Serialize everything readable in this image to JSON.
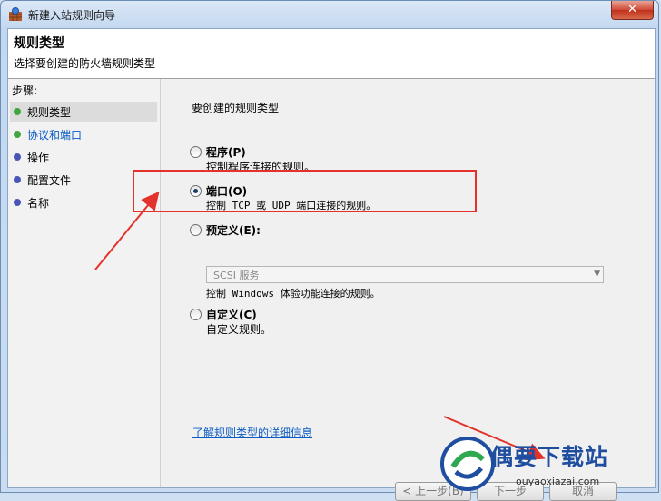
{
  "window": {
    "title": "新建入站规则向导",
    "close_glyph": "✕"
  },
  "header": {
    "title": "规则类型",
    "subtitle": "选择要创建的防火墙规则类型"
  },
  "sidebar": {
    "steps_label": "步骤:",
    "steps": [
      {
        "label": "规则类型",
        "dot_color": "#3fa640"
      },
      {
        "label": "协议和端口",
        "dot_color": "#3fa640"
      },
      {
        "label": "操作",
        "dot_color": "#4b55b8"
      },
      {
        "label": "配置文件",
        "dot_color": "#4b55b8"
      },
      {
        "label": "名称",
        "dot_color": "#4b55b8"
      }
    ]
  },
  "main": {
    "prompt": "要创建的规则类型",
    "options": [
      {
        "title": "程序(P)",
        "desc": "控制程序连接的规则。",
        "checked": false
      },
      {
        "title": "端口(O)",
        "desc": "控制 TCP 或 UDP 端口连接的规则。",
        "checked": true
      },
      {
        "title": "预定义(E):",
        "desc": "控制 Windows 体验功能连接的规则。",
        "checked": false
      },
      {
        "title": "自定义(C)",
        "desc": "自定义规则。",
        "checked": false
      }
    ],
    "predefined_select": {
      "value": "iSCSI 服务"
    },
    "info_link": "了解规则类型的详细信息"
  },
  "buttons": {
    "back": "< 上一步(B)",
    "next": "下一步",
    "cancel": "取消"
  },
  "watermark": {
    "text": "偶要下载站",
    "url": "ouyaoxiazai.com"
  },
  "colors": {
    "annotation": "#e3322c",
    "link": "#0b5bc4"
  }
}
